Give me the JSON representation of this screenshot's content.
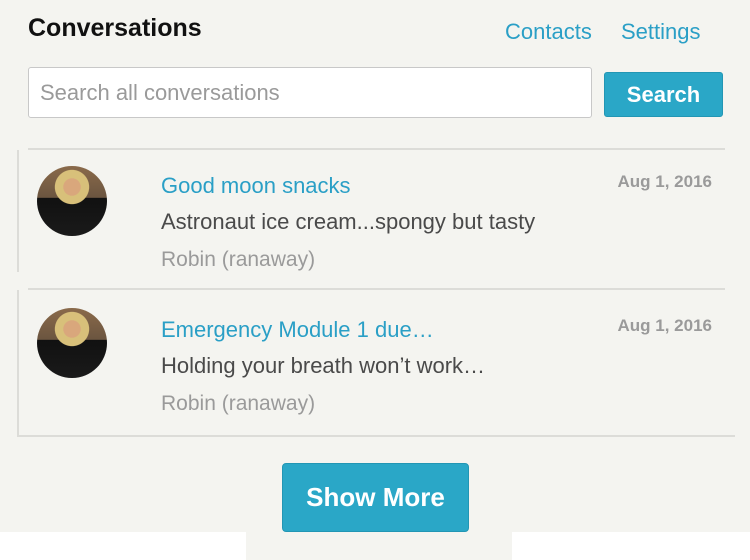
{
  "header": {
    "title": "Conversations",
    "contacts_label": "Contacts",
    "settings_label": "Settings"
  },
  "search": {
    "placeholder": "Search all conversations",
    "value": "",
    "button_label": "Search"
  },
  "conversations": [
    {
      "title": "Good moon snacks",
      "snippet": "Astronaut ice cream...spongy but tasty",
      "author": "Robin (ranaway)",
      "date": "Aug 1, 2016"
    },
    {
      "title": "Emergency Module 1 due…",
      "snippet": "Holding your breath won’t work…",
      "author": "Robin (ranaway)",
      "date": "Aug 1, 2016"
    }
  ],
  "show_more_label": "Show More",
  "colors": {
    "accent": "#2aa7c7",
    "link": "#2a9fc6",
    "background": "#f4f4f0"
  }
}
